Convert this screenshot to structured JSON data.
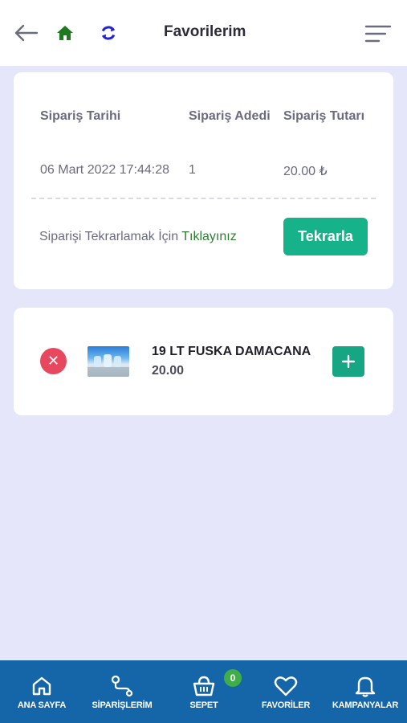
{
  "header": {
    "title": "Favorilerim",
    "icons": [
      "back-arrow-icon",
      "home-icon",
      "refresh-icon",
      "menu-icon"
    ],
    "colors": {
      "home": "#1f7a1f",
      "refresh": "#2323d8"
    }
  },
  "order": {
    "columns": [
      "Sipariş Tarihi",
      "Sipariş Adedi",
      "Sipariş Tutarı"
    ],
    "date": "06 Mart 2022 17:44:28",
    "quantity": "1",
    "total": "20.00 ₺",
    "repeat_text": "Siparişi Tekrarlamak İçin",
    "repeat_link": "Tıklayınız",
    "repeat_button": "Tekrarla"
  },
  "product": {
    "name": "19 LT FUSKA DAMACANA",
    "price": "20.00",
    "remove_symbol": "✕"
  },
  "bottom_nav": {
    "items": [
      {
        "label": "ANA SAYFA",
        "icon": "home-outline-icon"
      },
      {
        "label": "SİPARİŞLERİM",
        "icon": "route-icon"
      },
      {
        "label": "SEPET",
        "icon": "basket-icon"
      },
      {
        "label": "FAVORİLER",
        "icon": "heart-icon"
      },
      {
        "label": "KAMPANYALAR",
        "icon": "bell-icon"
      }
    ],
    "cart_badge": "0"
  },
  "colors": {
    "accent": "#16b38a",
    "nav_background": "#1566a8",
    "page_background": "#e6e6fb",
    "remove": "#e8485e",
    "badge": "#3fae49"
  }
}
